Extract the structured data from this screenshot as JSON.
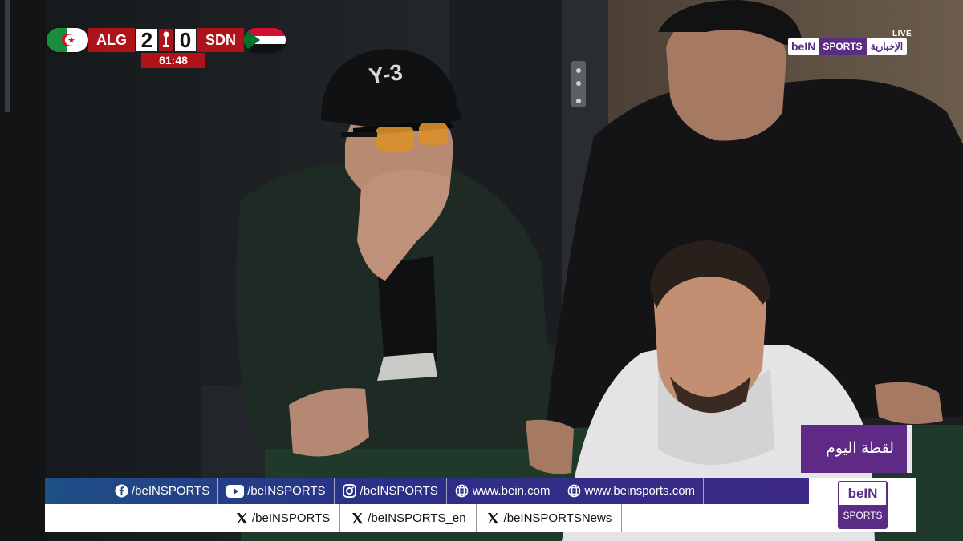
{
  "scoreboard": {
    "home_code": "ALG",
    "away_code": "SDN",
    "home_score": "2",
    "away_score": "0",
    "clock": "61:48"
  },
  "broadcaster": {
    "live_label": "LIVE",
    "logo_bein": "beIN",
    "logo_sports": "SPORTS",
    "logo_arabic": "الإخبارية"
  },
  "overlay": {
    "moment_label": "لقطة اليوم"
  },
  "cap_text": "Y-3",
  "ticker": {
    "row1": [
      {
        "icon": "facebook-icon",
        "text": "/beINSPORTS"
      },
      {
        "icon": "youtube-icon",
        "text": "/beINSPORTS"
      },
      {
        "icon": "instagram-icon",
        "text": "/beINSPORTS"
      },
      {
        "icon": "globe-icon",
        "text": "www.bein.com"
      },
      {
        "icon": "globe-icon",
        "text": "www.beinsports.com"
      }
    ],
    "row2": [
      {
        "icon": "x-icon",
        "text": "/beINSPORTS"
      },
      {
        "icon": "x-icon",
        "text": "/beINSPORTS_en"
      },
      {
        "icon": "x-icon",
        "text": "/beINSPORTSNews"
      }
    ],
    "logo_top": "beIN",
    "logo_bottom": "SPORTS"
  },
  "colors": {
    "scoreboard_red": "#b0121a",
    "bein_purple": "#5b2c83"
  }
}
